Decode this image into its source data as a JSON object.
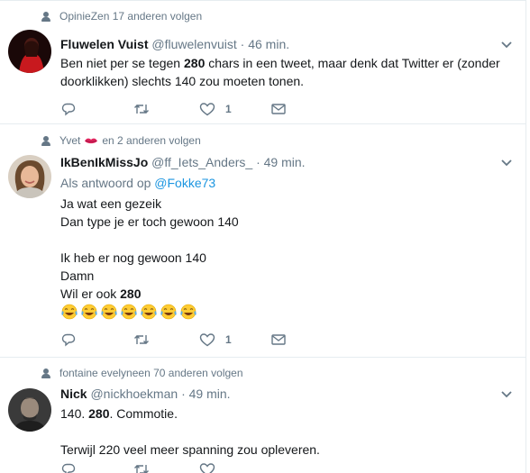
{
  "tweets": [
    {
      "context_prefix": "OpinieZ",
      "context_suffix": " en 17 anderen volgen",
      "name": "Fluwelen Vuist",
      "handle": "@fluwelenvuist",
      "time": "46 min.",
      "text_before": "Ben niet per se tegen ",
      "text_bold": "280",
      "text_after": " chars in een tweet, maar denk dat Twitter er (zonder\ndoorklikken) slechts 140 zou moeten tonen.",
      "like_count": "1"
    },
    {
      "context_prefix": "Yvet",
      "context_suffix": "en 2 anderen volgen",
      "name": "IkBenIkMissJo",
      "handle": "@ff_Iets_Anders_",
      "time": "49 min.",
      "reply_prefix": "Als antwoord op ",
      "reply_handle": "@Fokke73",
      "text_before": "Ja wat een gezeik\nDan type je er toch gewoon 140\n\nIk heb er nog gewoon 140\nDamn\nWil er ook ",
      "text_bold": "280",
      "like_count": "1",
      "emoji_count": 7
    },
    {
      "context_prefix": "fontaine evelyne",
      "context_suffix": " en 70 anderen volgen",
      "name": "Nick",
      "handle": "@nickhoekman",
      "time": "49 min.",
      "text_before": "140. ",
      "text_bold": "280",
      "text_after": ". Commotie.\n\nTerwijl 220 veel meer spanning zou opleveren."
    }
  ],
  "icons": {
    "reply": "reply-icon",
    "retweet": "retweet-icon",
    "like": "heart-icon",
    "dm": "envelope-icon",
    "more": "chevron-down-icon",
    "context": "person-icon"
  },
  "colors": {
    "link": "#1b95e0",
    "muted": "#657786",
    "text": "#14171a",
    "border": "#e6ecf0"
  }
}
